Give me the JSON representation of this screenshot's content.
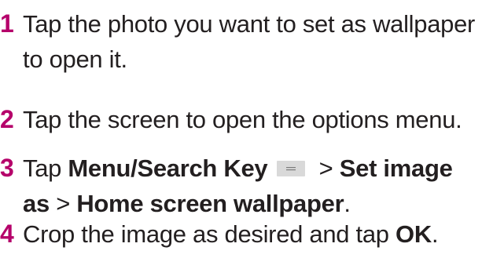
{
  "steps": [
    {
      "number": "1",
      "line1": "Tap the photo you want to set as wallpaper",
      "line2": "to open it."
    },
    {
      "number": "2",
      "text": "Tap the screen to open the options menu."
    },
    {
      "number": "3",
      "tap": "Tap ",
      "menu_key": "Menu/Search Key",
      "menu_key_icon": "menu-key-icon",
      "arrow1": " > ",
      "set_image": "Set image",
      "as": "as",
      "arrow2": " > ",
      "home_wallpaper": "Home screen wallpaper",
      "period": "."
    },
    {
      "number": "4",
      "text": "Crop the image as desired and tap ",
      "ok": "OK",
      "period": "."
    }
  ],
  "colors": {
    "step_number": "#b5006a",
    "text": "#231f20",
    "key_icon_bg": "#d9d9d9"
  }
}
